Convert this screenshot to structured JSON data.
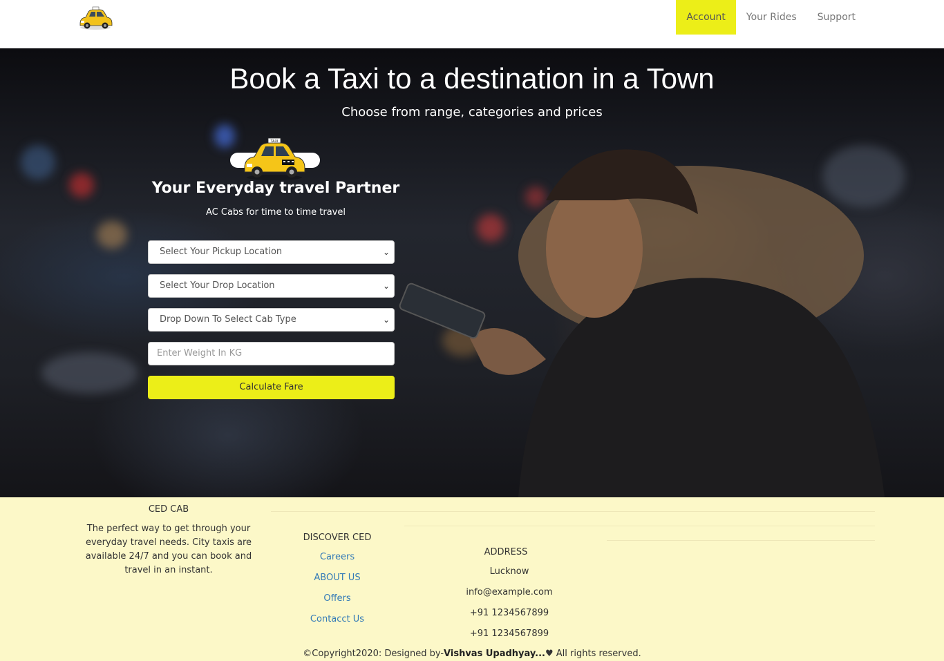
{
  "header": {
    "logo_icon": "taxi-icon",
    "nav": [
      {
        "label": "Account",
        "active": true
      },
      {
        "label": "Your Rides",
        "active": false
      },
      {
        "label": "Support",
        "active": false
      }
    ]
  },
  "hero": {
    "title": "Book a Taxi to a destination in a Town",
    "subtitle": "Choose from range, categories and prices",
    "partner_title": "Your Everyday travel Partner",
    "partner_sub": "AC Cabs for time to time travel",
    "pickup_select": "Select Your Pickup Location",
    "drop_select": "Select Your Drop Location",
    "cab_select": "Drop Down To Select Cab Type",
    "weight_placeholder": "Enter Weight In KG",
    "calculate_label": "Calculate Fare"
  },
  "footer": {
    "brand_title": "CED CAB",
    "brand_text": "The perfect way to get through your everyday travel needs. City taxis are available 24/7 and you can book and travel in an instant.",
    "discover_title": "DISCOVER CED",
    "discover_links": [
      "Careers",
      "ABOUT US",
      "Offers",
      "Contacct Us"
    ],
    "address_title": "ADDRESS",
    "address_lines": [
      "Lucknow",
      "info@example.com",
      "+91 1234567899",
      "+91 1234567899"
    ],
    "copyright_prefix": "©Copyright2020: Designed by-",
    "copyright_author": "Vishvas Upadhyay...",
    "copyright_heart": "♥",
    "copyright_suffix": " All rights reserved."
  },
  "colors": {
    "accent_yellow": "#ecee18",
    "footer_bg": "#fcf8c8",
    "link_blue": "#337ab7"
  }
}
